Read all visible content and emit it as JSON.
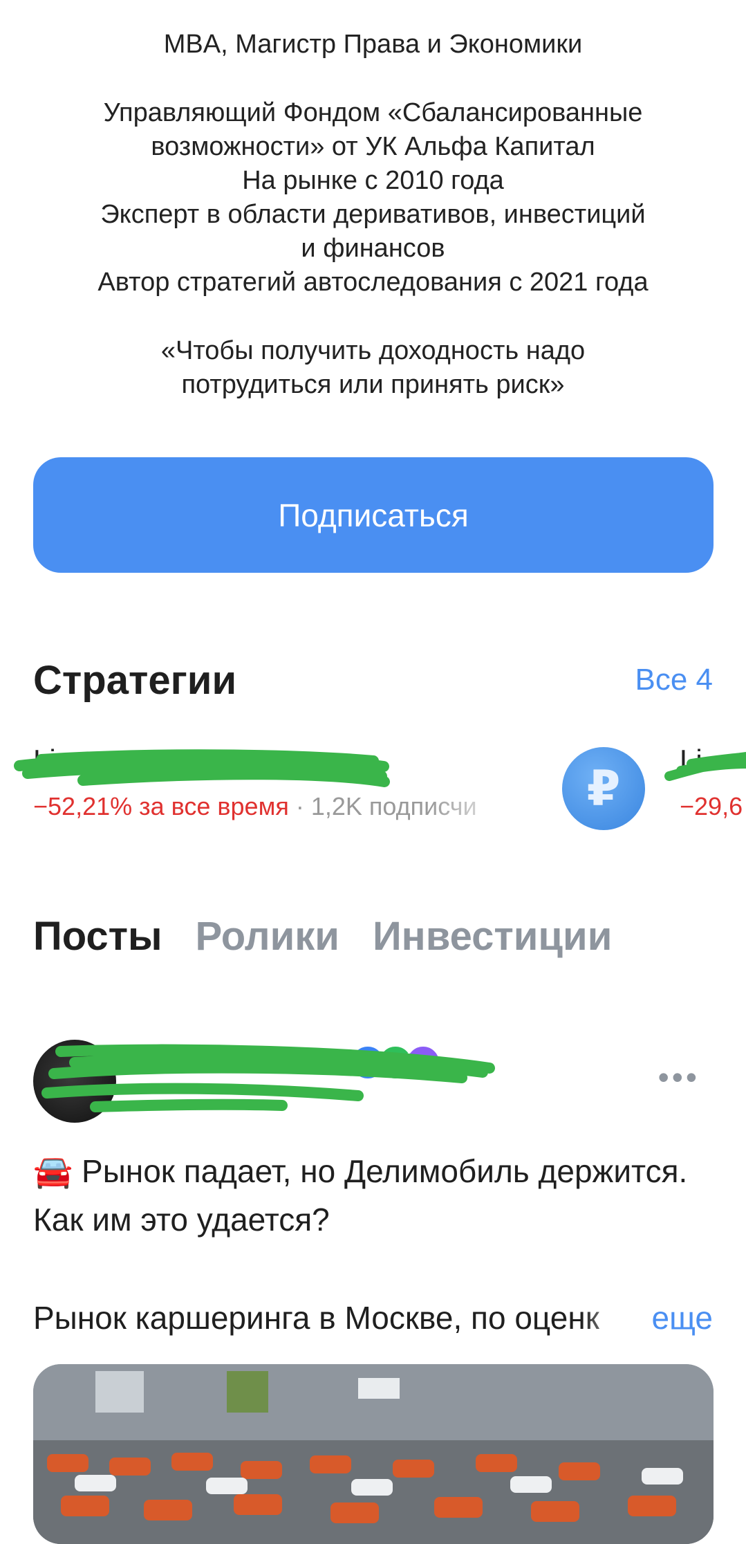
{
  "profile": {
    "bio_lines": [
      "MBA, Магистр Права и Экономики",
      "",
      "Управляющий Фондом «Сбалансированные",
      "возможности» от УК Альфа Капитал",
      "На рынке с 2010 года",
      "Эксперт в области деривативов, инвестиций",
      "и финансов",
      "Автор стратегий автоследования с 2021 года",
      "",
      "«Чтобы получить доходность надо",
      "потрудиться или принять риск»"
    ],
    "subscribe_label": "Подписаться"
  },
  "strategies": {
    "title": "Стратегии",
    "see_all_label": "Все 4",
    "items": [
      {
        "name": "Li",
        "return": "−52,21% за все время",
        "separator": "·",
        "subscribers": "1,2K подписчи"
      },
      {
        "icon_glyph": "₽",
        "name": "Li",
        "return": "−29,6"
      }
    ]
  },
  "tabs": [
    "Посты",
    "Ролики",
    "Инвестиции"
  ],
  "post": {
    "title": "🚘 Рынок падает, но Делимобиль держится. Как им это удается?",
    "text": "Рынок каршеринга в Москве, по оценк",
    "more_label": "еще",
    "more_icon": "ellipsis-icon"
  },
  "colors": {
    "accent": "#4a8ff2",
    "negative": "#e0312f",
    "muted": "#8e959e",
    "redaction": "#3ab54a"
  }
}
